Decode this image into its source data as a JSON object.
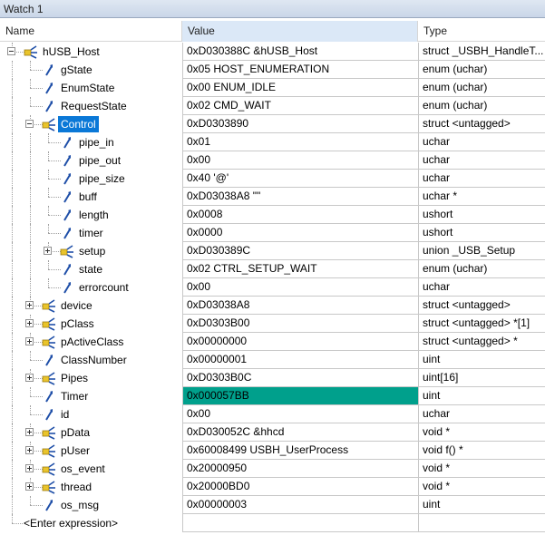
{
  "window": {
    "title": "Watch 1"
  },
  "header": {
    "name": "Name",
    "value": "Value",
    "type": "Type"
  },
  "rows": [
    {
      "name": "hUSB_Host",
      "value": "0xD030388C &hUSB_Host",
      "type": "struct _USBH_HandleT...",
      "level": 0,
      "expander": "minus",
      "icon": "struct-icon"
    },
    {
      "name": "gState",
      "value": "0x05 HOST_ENUMERATION",
      "type": "enum (uchar)",
      "level": 1,
      "expander": "none",
      "icon": "field-icon"
    },
    {
      "name": "EnumState",
      "value": "0x00 ENUM_IDLE",
      "type": "enum (uchar)",
      "level": 1,
      "expander": "none",
      "icon": "field-icon"
    },
    {
      "name": "RequestState",
      "value": "0x02 CMD_WAIT",
      "type": "enum (uchar)",
      "level": 1,
      "expander": "none",
      "icon": "field-icon"
    },
    {
      "name": "Control",
      "value": "0xD0303890",
      "type": "struct <untagged>",
      "level": 1,
      "expander": "minus",
      "icon": "struct-icon",
      "selected": true
    },
    {
      "name": "pipe_in",
      "value": "0x01",
      "type": "uchar",
      "level": 2,
      "expander": "none",
      "icon": "field-icon"
    },
    {
      "name": "pipe_out",
      "value": "0x00",
      "type": "uchar",
      "level": 2,
      "expander": "none",
      "icon": "field-icon"
    },
    {
      "name": "pipe_size",
      "value": "0x40 '@'",
      "type": "uchar",
      "level": 2,
      "expander": "none",
      "icon": "field-icon"
    },
    {
      "name": "buff",
      "value": "0xD03038A8 \"\"",
      "type": "uchar *",
      "level": 2,
      "expander": "none",
      "icon": "field-icon"
    },
    {
      "name": "length",
      "value": "0x0008",
      "type": "ushort",
      "level": 2,
      "expander": "none",
      "icon": "field-icon"
    },
    {
      "name": "timer",
      "value": "0x0000",
      "type": "ushort",
      "level": 2,
      "expander": "none",
      "icon": "field-icon"
    },
    {
      "name": "setup",
      "value": "0xD030389C",
      "type": "union _USB_Setup",
      "level": 2,
      "expander": "plus",
      "icon": "struct-icon"
    },
    {
      "name": "state",
      "value": "0x02 CTRL_SETUP_WAIT",
      "type": "enum (uchar)",
      "level": 2,
      "expander": "none",
      "icon": "field-icon"
    },
    {
      "name": "errorcount",
      "value": "0x00",
      "type": "uchar",
      "level": 2,
      "expander": "none",
      "icon": "field-icon"
    },
    {
      "name": "device",
      "value": "0xD03038A8",
      "type": "struct <untagged>",
      "level": 1,
      "expander": "plus",
      "icon": "struct-icon"
    },
    {
      "name": "pClass",
      "value": "0xD0303B00",
      "type": "struct <untagged> *[1]",
      "level": 1,
      "expander": "plus",
      "icon": "struct-icon"
    },
    {
      "name": "pActiveClass",
      "value": "0x00000000",
      "type": "struct <untagged> *",
      "level": 1,
      "expander": "plus",
      "icon": "struct-icon"
    },
    {
      "name": "ClassNumber",
      "value": "0x00000001",
      "type": "uint",
      "level": 1,
      "expander": "none",
      "icon": "field-icon"
    },
    {
      "name": "Pipes",
      "value": "0xD0303B0C",
      "type": "uint[16]",
      "level": 1,
      "expander": "plus",
      "icon": "struct-icon"
    },
    {
      "name": "Timer",
      "value": "0x000057BB",
      "type": "uint",
      "level": 1,
      "expander": "none",
      "icon": "field-icon",
      "changed": true
    },
    {
      "name": "id",
      "value": "0x00",
      "type": "uchar",
      "level": 1,
      "expander": "none",
      "icon": "field-icon"
    },
    {
      "name": "pData",
      "value": "0xD030052C &hhcd",
      "type": "void *",
      "level": 1,
      "expander": "plus",
      "icon": "struct-icon"
    },
    {
      "name": "pUser",
      "value": "0x60008499 USBH_UserProcess",
      "type": "void f()  *",
      "level": 1,
      "expander": "plus",
      "icon": "struct-icon"
    },
    {
      "name": "os_event",
      "value": "0x20000950",
      "type": "void *",
      "level": 1,
      "expander": "plus",
      "icon": "struct-icon"
    },
    {
      "name": "thread",
      "value": "0x20000BD0",
      "type": "void *",
      "level": 1,
      "expander": "plus",
      "icon": "struct-icon"
    },
    {
      "name": "os_msg",
      "value": "0x00000003",
      "type": "uint",
      "level": 1,
      "expander": "none",
      "icon": "field-icon"
    },
    {
      "name": "<Enter expression>",
      "value": "",
      "type": "",
      "level": 0,
      "expander": "none",
      "icon": "none",
      "enter": true
    }
  ],
  "colors": {
    "changed_value": "#00a08c",
    "selection": "#0a78d7"
  }
}
